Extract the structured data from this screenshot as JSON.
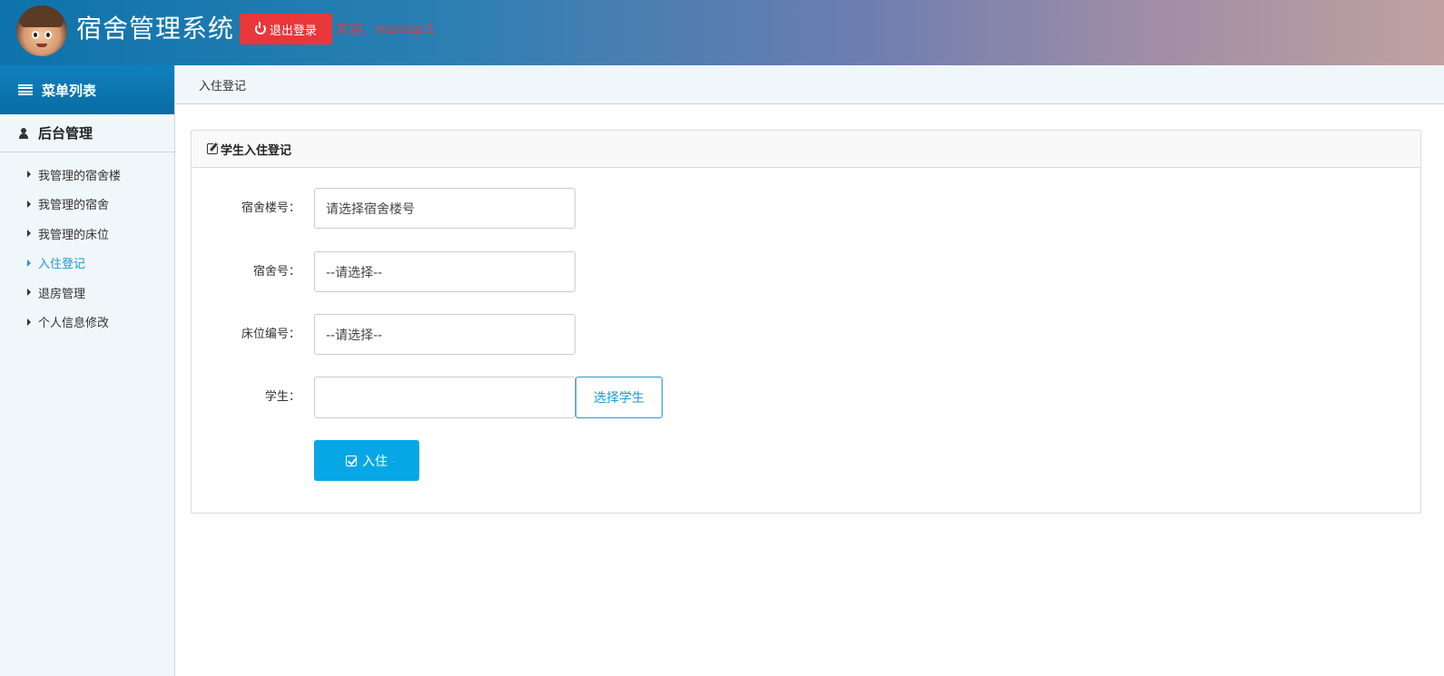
{
  "header": {
    "title": "宿舍管理系统",
    "logout_label": "退出登录",
    "welcome": "欢迎，manage1",
    "accent_color": "#e8373b"
  },
  "sidebar": {
    "menu_title": "菜单列表",
    "group_title": "后台管理",
    "items": [
      {
        "label": "我管理的宿舍楼",
        "active": false
      },
      {
        "label": "我管理的宿舍",
        "active": false
      },
      {
        "label": "我管理的床位",
        "active": false
      },
      {
        "label": "入住登记",
        "active": true
      },
      {
        "label": "退房管理",
        "active": false
      },
      {
        "label": "个人信息修改",
        "active": false
      }
    ]
  },
  "breadcrumb": {
    "current": "入住登记"
  },
  "panel": {
    "title": "学生入住登记"
  },
  "form": {
    "building": {
      "label": "宿舍楼号：",
      "value": "请选择宿舍楼号"
    },
    "room": {
      "label": "宿舍号：",
      "value": "--请选择--"
    },
    "bed": {
      "label": "床位编号：",
      "value": "--请选择--"
    },
    "student": {
      "label": "学生：",
      "value": "",
      "choose_label": "选择学生"
    },
    "submit_label": "入住"
  },
  "icons": {
    "logout": "power-icon",
    "menu": "list-icon",
    "group": "user-icon",
    "panel": "edit-icon",
    "submit": "check-square-icon"
  }
}
